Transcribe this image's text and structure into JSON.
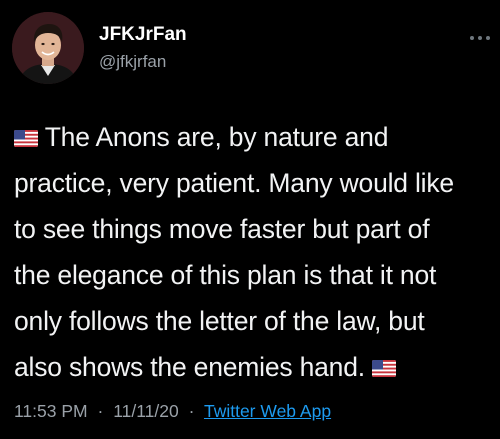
{
  "tweet": {
    "display_name": "JFKJrFan",
    "handle": "@jfkjrfan",
    "more_icon": "more-horizontal-icon",
    "avatar_icon": "profile-photo",
    "flag_icon": "us-flag-emoji",
    "text_lines": [
      "The Anons are, by nature and",
      "practice, very patient. Many would like",
      "to see things move faster but part of",
      "the elegance of this plan is that it not",
      "only follows the letter of the law, but",
      "also shows the enemies hand."
    ],
    "time": "11:53 PM",
    "date": "11/11/20",
    "separator": "·",
    "source": "Twitter Web App"
  },
  "colors": {
    "background": "#000000",
    "name": "#ffffff",
    "secondary": "#9aa1a8",
    "link": "#1d9bf0"
  }
}
